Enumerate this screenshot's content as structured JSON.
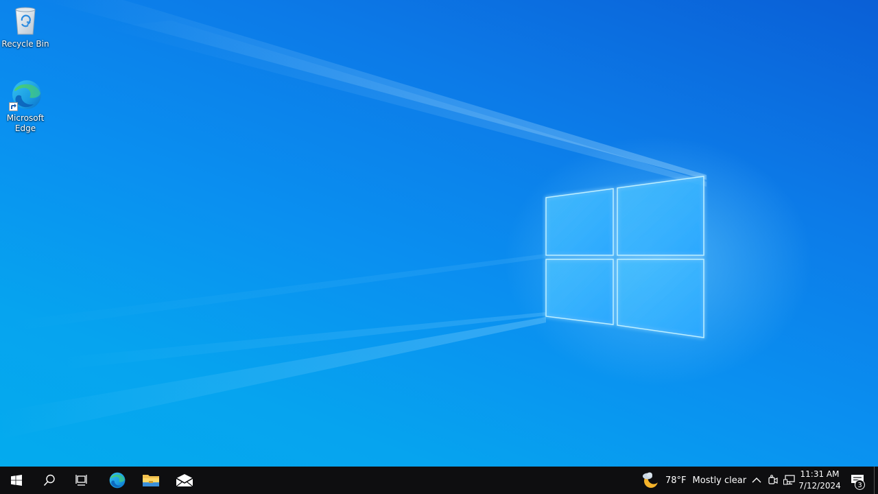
{
  "desktop": {
    "icons": [
      {
        "label": "Recycle Bin",
        "icon": "recycle-bin-icon"
      },
      {
        "label": "Microsoft Edge",
        "icon": "edge-icon"
      }
    ],
    "wallpaper": "windows-10-hero-logo"
  },
  "taskbar": {
    "background": "#0e0e10",
    "buttons": [
      {
        "name": "start",
        "icon": "windows-start-icon"
      },
      {
        "name": "search",
        "icon": "search-icon"
      },
      {
        "name": "task-view",
        "icon": "task-view-icon"
      },
      {
        "name": "edge",
        "icon": "edge-icon"
      },
      {
        "name": "file-explorer",
        "icon": "folder-icon"
      },
      {
        "name": "mail",
        "icon": "mail-icon"
      }
    ],
    "weather": {
      "temp": "78°F",
      "condition": "Mostly clear",
      "icon": "moon-cloud-icon"
    },
    "tray": {
      "icons": [
        "chevron-up-icon",
        "meet-now-icon",
        "network-icon"
      ]
    },
    "clock": {
      "time": "11:31 AM",
      "date": "7/12/2024"
    },
    "notifications": {
      "count": "3",
      "icon": "action-center-icon"
    }
  },
  "colors": {
    "wallpaper_top": "#0a5fd6",
    "wallpaper_bottom": "#04abee",
    "logo_glow": "#7fd8ff"
  }
}
